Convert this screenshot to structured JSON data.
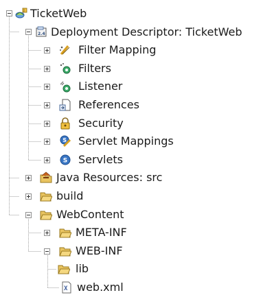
{
  "tree": {
    "project": "TicketWeb",
    "descriptor": {
      "label": "Deployment Descriptor: TicketWeb",
      "children": [
        "Filter Mapping",
        "Filters",
        "Listener",
        "References",
        "Security",
        "Servlet Mappings",
        "Servlets"
      ]
    },
    "java_resources": "Java Resources: src",
    "build": "build",
    "webcontent": {
      "label": "WebContent",
      "children": [
        "META-INF",
        "WEB-INF"
      ],
      "webinf_children": [
        "lib",
        "web.xml"
      ]
    }
  },
  "icons": {
    "project": "web-project-icon",
    "descriptor": "deployment-descriptor-icon",
    "filter_mapping": "filter-mapping-icon",
    "filters": "filters-icon",
    "listener": "listener-icon",
    "references": "references-icon",
    "security": "security-icon",
    "servlet_mappings": "servlet-mappings-icon",
    "servlets": "servlets-icon",
    "folder": "folder-icon",
    "xml_file": "xml-file-icon"
  },
  "colors": {
    "folder": "#e9c460",
    "servlet_blue": "#3a76c4",
    "guide_line": "#a0a0a0",
    "text": "#1a1a1a"
  }
}
